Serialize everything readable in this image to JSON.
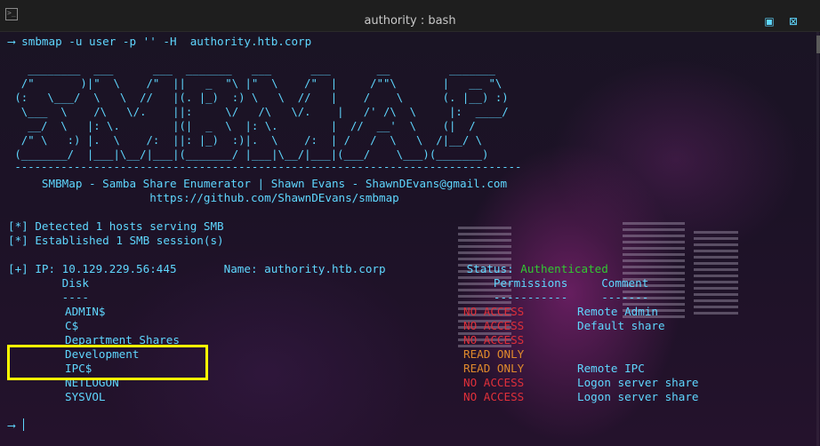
{
  "window": {
    "title": "authority : bash"
  },
  "terminal": {
    "command_line": "⟶ smbmap -u user -p '' -H  authority.htb.corp",
    "banner": [
      "   ________  ___      ___  _______   ___      ___       __         _______",
      "  /\"       )|\"  \\    /\"  ||   _  \"\\ |\"  \\    /\"  |     /\"\"\\       |   __ \"\\",
      " (:   \\___/  \\   \\  //   |(. |_)  :) \\   \\  //   |    /    \\      (. |__) :)",
      "  \\___  \\    /\\   \\/.    ||:     \\/   /\\   \\/.    |   /' /\\  \\     |:  ____/",
      "   __/  \\   |: \\.        |(|  _  \\  |: \\.        |  //  __'  \\    (|  /",
      "  /\" \\   :) |.  \\    /:  ||: |_)  :)|.  \\    /:  | /   /  \\   \\  /|__/ \\",
      " (_______/  |___|\\__/|___|(_______/ |___|\\__/|___|(___/    \\___)(_______)",
      " -----------------------------------------------------------------------------"
    ],
    "tagline": "     SMBMap - Samba Share Enumerator | Shawn Evans - ShawnDEvans@gmail.com",
    "url": "                     https://github.com/ShawnDEvans/smbmap",
    "detected": "[*] Detected 1 hosts serving SMB",
    "established": "[*] Established 1 SMB session(s)",
    "host_line": "[+] IP: 10.129.229.56:445       Name: authority.htb.corp            Status: ",
    "status": "Authenticated",
    "header": "        Disk                                                            Permissions     Comment",
    "separator": "        ----                                                            -----------     -------",
    "shares": [
      {
        "name": "ADMIN$",
        "permission": "NO ACCESS",
        "comment": "Remote Admin"
      },
      {
        "name": "C$",
        "permission": "NO ACCESS",
        "comment": "Default share"
      },
      {
        "name": "Department Shares",
        "permission": "NO ACCESS",
        "comment": ""
      },
      {
        "name": "Development",
        "permission": "READ ONLY",
        "comment": ""
      },
      {
        "name": "IPC$",
        "permission": "READ ONLY",
        "comment": "Remote IPC"
      },
      {
        "name": "NETLOGON",
        "permission": "NO ACCESS",
        "comment": "Logon server share"
      },
      {
        "name": "SYSVOL",
        "permission": "NO ACCESS",
        "comment": "Logon server share"
      }
    ],
    "prompt": "⟶"
  },
  "colors": {
    "text": "#5fd7ff",
    "no_access": "#e0303a",
    "read_only": "#e08a2c",
    "authenticated": "#32c832",
    "highlight": "#ffff00"
  },
  "icons": [
    "terminal-icon",
    "maximize-icon",
    "close-icon"
  ]
}
